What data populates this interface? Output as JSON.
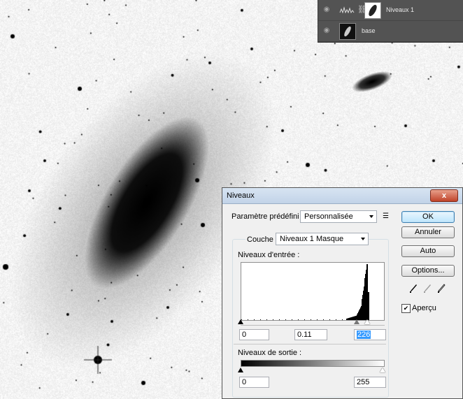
{
  "layers": [
    {
      "name": "Niveaux 1",
      "icon": "levels-adjustment-icon"
    },
    {
      "name": "base",
      "icon": "image-thumbnail-icon"
    }
  ],
  "dialog": {
    "title": "Niveaux",
    "close_label": "x",
    "preset_label": "Paramètre prédéfini :",
    "preset_value": "Personnalisée",
    "channel_label": "Couche :",
    "channel_value": "Niveaux 1 Masque",
    "input_levels_label": "Niveaux d'entrée :",
    "input_black": "0",
    "input_gamma": "0.11",
    "input_white": "226",
    "output_levels_label": "Niveaux de sortie :",
    "output_black": "0",
    "output_white": "255",
    "buttons": {
      "ok": "OK",
      "cancel": "Annuler",
      "auto": "Auto",
      "options": "Options..."
    },
    "preview_label": "Aperçu",
    "preview_checked": true
  }
}
